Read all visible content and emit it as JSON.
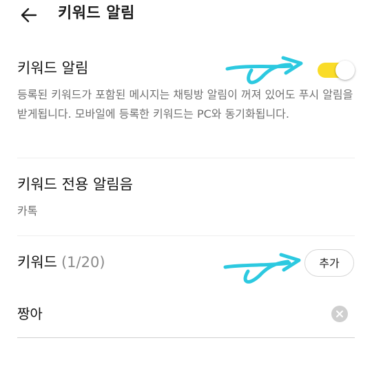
{
  "header": {
    "title": "키워드 알림"
  },
  "keyword_alert": {
    "title": "키워드 알림",
    "enabled": true,
    "description": "등록된 키워드가 포함된 메시지는 채팅방 알림이 꺼져 있어도 푸시 알림을 받게됩니다. 모바일에 등록한 키워드는 PC와 동기화됩니다."
  },
  "alert_sound": {
    "title": "키워드 전용 알림음",
    "value": "카톡"
  },
  "keywords": {
    "title": "키워드",
    "count": "(1/20)",
    "add_label": "추가",
    "items": [
      {
        "text": "짱아"
      }
    ]
  },
  "colors": {
    "toggle_on": "#fadc28",
    "annotation": "#2cc9e0"
  }
}
